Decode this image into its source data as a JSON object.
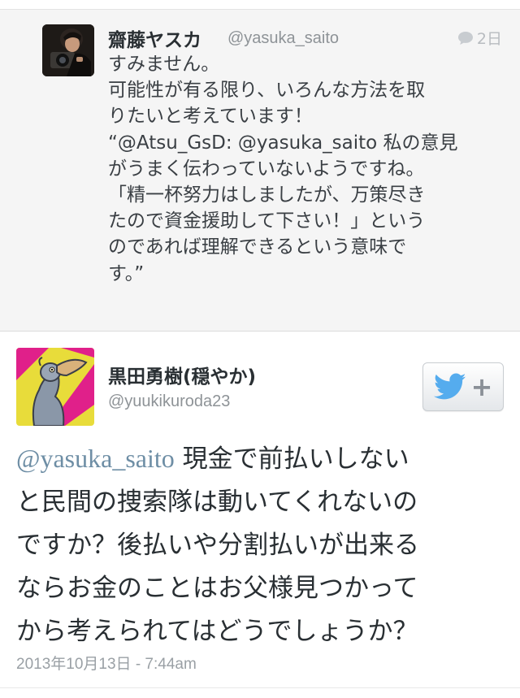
{
  "parent_tweet": {
    "display_name": "齋藤ヤスカ",
    "handle": "@yasuka_saito",
    "time_ago": "2日",
    "lines": [
      "すみません。",
      "可能性が有る限り、いろんな方法を取",
      "りたいと考えています！",
      "“@Atsu_GsD: @yasuka_saito 私の意見",
      "がうまく伝わっていないようですね。",
      "「精一杯努力はしましたが、万策尽き",
      "たので資金援助して下さい！」という",
      "のであれば理解できるという意味で",
      "す。”"
    ]
  },
  "tweet": {
    "display_name": "黒田勇樹(穏やか)",
    "handle": "@yuukikuroda23",
    "mention": "@yasuka_saito",
    "first_line_rest": " 現金で前払いしない",
    "lines": [
      "と民間の捜索隊は動いてくれないの",
      "ですか？後払いや分割払いが出来る",
      "ならお金のことはお父様見つかって",
      "から考えられてはどうでしょうか？"
    ],
    "date": "2013年10月13日 - 7:44am"
  },
  "follow_button": {
    "icon": "twitter-bird-icon",
    "plus": "+"
  },
  "colors": {
    "accent_blue": "#55acee",
    "mention_color": "#6e8ea5",
    "secondary_text": "#8e9397"
  }
}
